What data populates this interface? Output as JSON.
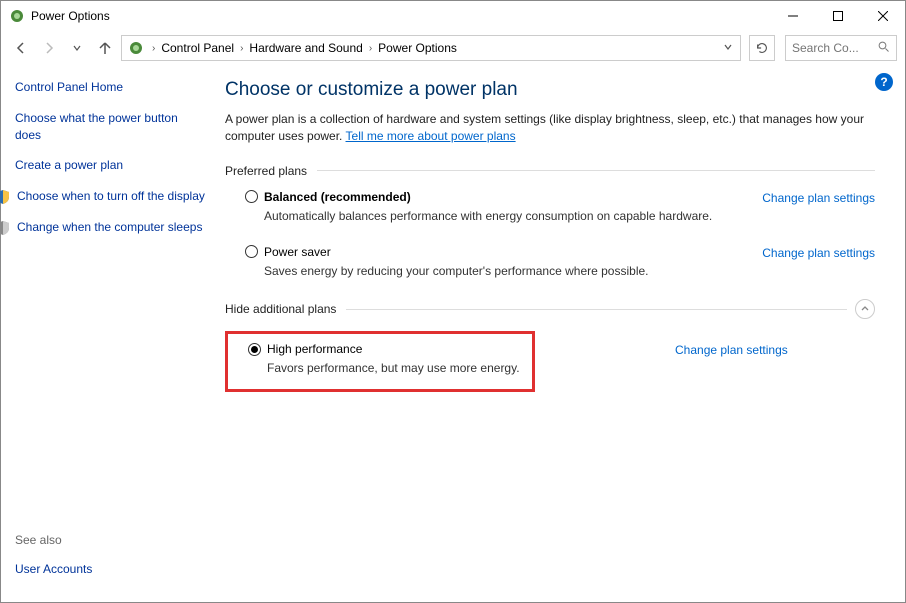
{
  "titlebar": {
    "title": "Power Options"
  },
  "breadcrumbs": {
    "item1": "Control Panel",
    "item2": "Hardware and Sound",
    "item3": "Power Options"
  },
  "search": {
    "placeholder": "Search Co..."
  },
  "sidebar": {
    "home": "Control Panel Home",
    "link1": "Choose what the power button does",
    "link2": "Create a power plan",
    "link3": "Choose when to turn off the display",
    "link4": "Change when the computer sleeps",
    "see_also_label": "See also",
    "see_also_link": "User Accounts"
  },
  "main": {
    "heading": "Choose or customize a power plan",
    "intro_text": "A power plan is a collection of hardware and system settings (like display brightness, sleep, etc.) that manages how your computer uses power. ",
    "intro_link": "Tell me more about power plans",
    "preferred_label": "Preferred plans",
    "hide_label": "Hide additional plans",
    "change_link": "Change plan settings",
    "plans": {
      "balanced": {
        "name": "Balanced (recommended)",
        "desc": "Automatically balances performance with energy consumption on capable hardware."
      },
      "saver": {
        "name": "Power saver",
        "desc": "Saves energy by reducing your computer's performance where possible."
      },
      "high": {
        "name": "High performance",
        "desc": "Favors performance, but may use more energy."
      }
    }
  }
}
